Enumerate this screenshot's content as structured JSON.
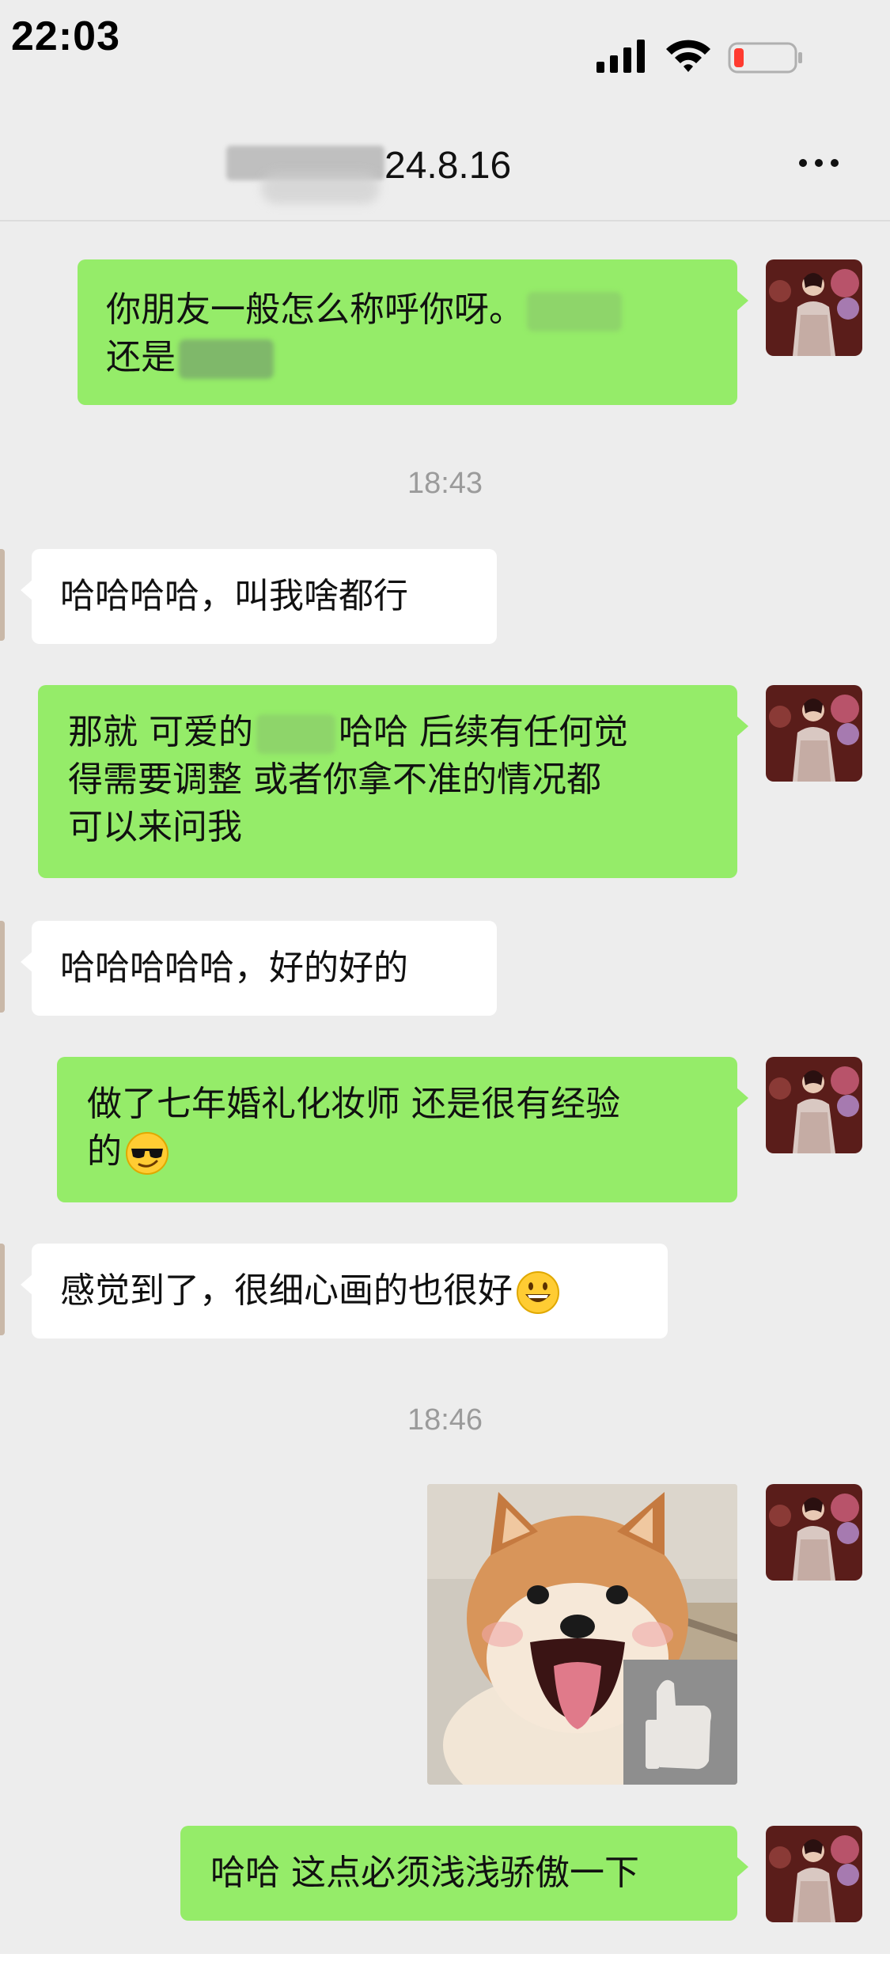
{
  "status_bar": {
    "time": "22:03",
    "icons": [
      "cellular-signal-icon",
      "wifi-icon",
      "battery-low-icon"
    ],
    "battery_color": "#ff3b30"
  },
  "header": {
    "title_visible_part": "24.8.16",
    "more_icon": "ellipsis-icon"
  },
  "colors": {
    "outgoing_bubble": "#95ec69",
    "incoming_bubble": "#ffffff",
    "background": "#ededed",
    "timestamp": "#9b9b9b"
  },
  "messages": [
    {
      "direction": "outgoing",
      "lines": [
        "你朋友一般怎么称呼你呀。",
        "还是"
      ]
    },
    {
      "type": "timestamp",
      "text": "18:43"
    },
    {
      "direction": "incoming",
      "text": "哈哈哈哈，叫我啥都行"
    },
    {
      "direction": "outgoing",
      "lines": [
        "那就 可爱的",
        "哈哈 后续有任何觉",
        "得需要调整 或者你拿不准的情况都",
        "可以来问我"
      ]
    },
    {
      "direction": "incoming",
      "text": "哈哈哈哈哈，好的好的"
    },
    {
      "direction": "outgoing",
      "lines": [
        "做了七年婚礼化妆师 还是很有经验",
        "的"
      ],
      "emoji": "sunglasses-face-icon"
    },
    {
      "direction": "incoming",
      "text": "感觉到了，很细心画的也很好",
      "emoji": "grinning-face-icon"
    },
    {
      "type": "timestamp",
      "text": "18:46"
    },
    {
      "direction": "outgoing",
      "type": "sticker",
      "sticker": "shiba-dog-thumbs-up-sticker"
    },
    {
      "direction": "outgoing",
      "text": "哈哈 这点必须浅浅骄傲一下"
    }
  ]
}
